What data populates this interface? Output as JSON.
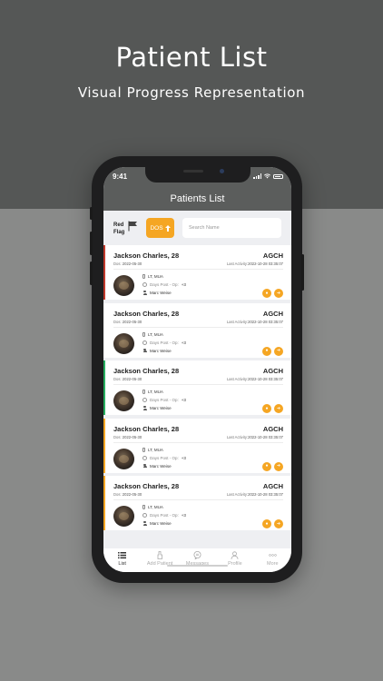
{
  "promo": {
    "title": "Patient List",
    "subtitle": "Visual Progress Representation"
  },
  "status_bar": {
    "time": "9:41"
  },
  "app": {
    "title": "Patients List"
  },
  "filters": {
    "red_flag_label_line1": "Red",
    "red_flag_label_line2": "Flag",
    "dos_label": "DOS",
    "search_placeholder": "Search Name",
    "search_value": ""
  },
  "patients": [
    {
      "name": "Jackson Charles, 28",
      "hospital": "AGCH",
      "dos_label": "Dos:",
      "dos": "2022-05-30",
      "activity_label": "Last Activity:",
      "last_activity": "2022-10-28 03:35:07",
      "procedure": "LT, MUA",
      "days_label": "Days Post - Op:",
      "days_value": "+3",
      "doctor": "Marc Weise",
      "status_color": "#c0392b"
    },
    {
      "name": "Jackson Charles, 28",
      "hospital": "AGCH",
      "dos_label": "Dos:",
      "dos": "2022-05-30",
      "activity_label": "Last Activity:",
      "last_activity": "2022-10-28 03:35:07",
      "procedure": "LT, MUA",
      "days_label": "Days Post - Op:",
      "days_value": "+3",
      "doctor": "Marc Weise",
      "status_color": "#ffffff"
    },
    {
      "name": "Jackson Charles, 28",
      "hospital": "AGCH",
      "dos_label": "Dos:",
      "dos": "2022-05-30",
      "activity_label": "Last Activity:",
      "last_activity": "2022-10-28 03:35:07",
      "procedure": "LT, MUA",
      "days_label": "Days Post - Op:",
      "days_value": "+3",
      "doctor": "Marc Weise",
      "status_color": "#27ae60"
    },
    {
      "name": "Jackson Charles, 28",
      "hospital": "AGCH",
      "dos_label": "Dos:",
      "dos": "2022-05-30",
      "activity_label": "Last Activity:",
      "last_activity": "2022-10-28 03:35:07",
      "procedure": "LT, MUA",
      "days_label": "Days Post - Op:",
      "days_value": "+3",
      "doctor": "Marc Weise",
      "status_color": "#f5a623"
    },
    {
      "name": "Jackson Charles, 28",
      "hospital": "AGCH",
      "dos_label": "Dos:",
      "dos": "2022-05-30",
      "activity_label": "Last Activity:",
      "last_activity": "2022-10-28 03:35:07",
      "procedure": "LT, MUA",
      "days_label": "Days Post - Op:",
      "days_value": "+3",
      "doctor": "Marc Weise",
      "status_color": "#f5a623"
    }
  ],
  "tabs": [
    {
      "label": "List",
      "icon": "list-icon",
      "active": true
    },
    {
      "label": "Add Patient",
      "icon": "add-patient-icon",
      "active": false
    },
    {
      "label": "Messages",
      "icon": "messages-icon",
      "active": false
    },
    {
      "label": "Profile",
      "icon": "profile-icon",
      "active": false
    },
    {
      "label": "More",
      "icon": "more-icon",
      "active": false
    }
  ],
  "colors": {
    "accent": "#f5a623",
    "header": "#5b5d5c",
    "top_background": "#555756",
    "bottom_background": "#898a89"
  }
}
